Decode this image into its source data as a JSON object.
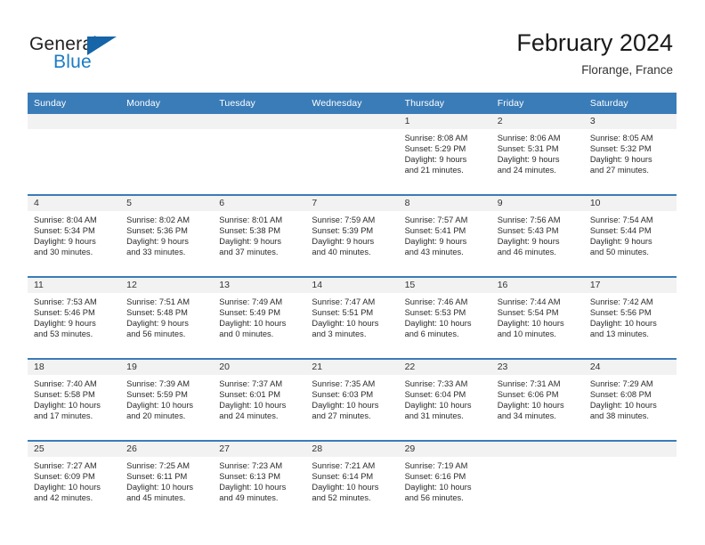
{
  "brand": {
    "name_top": "General",
    "name_bottom": "Blue",
    "accent_color": "#1b7bc4",
    "triangle_color": "#1565a8",
    "triangle_icon": "triangle-icon"
  },
  "header": {
    "title": "February 2024",
    "subtitle": "Florange, France",
    "header_bg_color": "#3a7cb8",
    "daynum_band_color": "#f2f2f2"
  },
  "weekday_headers": [
    "Sunday",
    "Monday",
    "Tuesday",
    "Wednesday",
    "Thursday",
    "Friday",
    "Saturday"
  ],
  "weeks": [
    [
      {
        "day": "",
        "sunrise": "",
        "sunset": "",
        "daylight_1": "",
        "daylight_2": ""
      },
      {
        "day": "",
        "sunrise": "",
        "sunset": "",
        "daylight_1": "",
        "daylight_2": ""
      },
      {
        "day": "",
        "sunrise": "",
        "sunset": "",
        "daylight_1": "",
        "daylight_2": ""
      },
      {
        "day": "",
        "sunrise": "",
        "sunset": "",
        "daylight_1": "",
        "daylight_2": ""
      },
      {
        "day": "1",
        "sunrise": "Sunrise: 8:08 AM",
        "sunset": "Sunset: 5:29 PM",
        "daylight_1": "Daylight: 9 hours",
        "daylight_2": "and 21 minutes."
      },
      {
        "day": "2",
        "sunrise": "Sunrise: 8:06 AM",
        "sunset": "Sunset: 5:31 PM",
        "daylight_1": "Daylight: 9 hours",
        "daylight_2": "and 24 minutes."
      },
      {
        "day": "3",
        "sunrise": "Sunrise: 8:05 AM",
        "sunset": "Sunset: 5:32 PM",
        "daylight_1": "Daylight: 9 hours",
        "daylight_2": "and 27 minutes."
      }
    ],
    [
      {
        "day": "4",
        "sunrise": "Sunrise: 8:04 AM",
        "sunset": "Sunset: 5:34 PM",
        "daylight_1": "Daylight: 9 hours",
        "daylight_2": "and 30 minutes."
      },
      {
        "day": "5",
        "sunrise": "Sunrise: 8:02 AM",
        "sunset": "Sunset: 5:36 PM",
        "daylight_1": "Daylight: 9 hours",
        "daylight_2": "and 33 minutes."
      },
      {
        "day": "6",
        "sunrise": "Sunrise: 8:01 AM",
        "sunset": "Sunset: 5:38 PM",
        "daylight_1": "Daylight: 9 hours",
        "daylight_2": "and 37 minutes."
      },
      {
        "day": "7",
        "sunrise": "Sunrise: 7:59 AM",
        "sunset": "Sunset: 5:39 PM",
        "daylight_1": "Daylight: 9 hours",
        "daylight_2": "and 40 minutes."
      },
      {
        "day": "8",
        "sunrise": "Sunrise: 7:57 AM",
        "sunset": "Sunset: 5:41 PM",
        "daylight_1": "Daylight: 9 hours",
        "daylight_2": "and 43 minutes."
      },
      {
        "day": "9",
        "sunrise": "Sunrise: 7:56 AM",
        "sunset": "Sunset: 5:43 PM",
        "daylight_1": "Daylight: 9 hours",
        "daylight_2": "and 46 minutes."
      },
      {
        "day": "10",
        "sunrise": "Sunrise: 7:54 AM",
        "sunset": "Sunset: 5:44 PM",
        "daylight_1": "Daylight: 9 hours",
        "daylight_2": "and 50 minutes."
      }
    ],
    [
      {
        "day": "11",
        "sunrise": "Sunrise: 7:53 AM",
        "sunset": "Sunset: 5:46 PM",
        "daylight_1": "Daylight: 9 hours",
        "daylight_2": "and 53 minutes."
      },
      {
        "day": "12",
        "sunrise": "Sunrise: 7:51 AM",
        "sunset": "Sunset: 5:48 PM",
        "daylight_1": "Daylight: 9 hours",
        "daylight_2": "and 56 minutes."
      },
      {
        "day": "13",
        "sunrise": "Sunrise: 7:49 AM",
        "sunset": "Sunset: 5:49 PM",
        "daylight_1": "Daylight: 10 hours",
        "daylight_2": "and 0 minutes."
      },
      {
        "day": "14",
        "sunrise": "Sunrise: 7:47 AM",
        "sunset": "Sunset: 5:51 PM",
        "daylight_1": "Daylight: 10 hours",
        "daylight_2": "and 3 minutes."
      },
      {
        "day": "15",
        "sunrise": "Sunrise: 7:46 AM",
        "sunset": "Sunset: 5:53 PM",
        "daylight_1": "Daylight: 10 hours",
        "daylight_2": "and 6 minutes."
      },
      {
        "day": "16",
        "sunrise": "Sunrise: 7:44 AM",
        "sunset": "Sunset: 5:54 PM",
        "daylight_1": "Daylight: 10 hours",
        "daylight_2": "and 10 minutes."
      },
      {
        "day": "17",
        "sunrise": "Sunrise: 7:42 AM",
        "sunset": "Sunset: 5:56 PM",
        "daylight_1": "Daylight: 10 hours",
        "daylight_2": "and 13 minutes."
      }
    ],
    [
      {
        "day": "18",
        "sunrise": "Sunrise: 7:40 AM",
        "sunset": "Sunset: 5:58 PM",
        "daylight_1": "Daylight: 10 hours",
        "daylight_2": "and 17 minutes."
      },
      {
        "day": "19",
        "sunrise": "Sunrise: 7:39 AM",
        "sunset": "Sunset: 5:59 PM",
        "daylight_1": "Daylight: 10 hours",
        "daylight_2": "and 20 minutes."
      },
      {
        "day": "20",
        "sunrise": "Sunrise: 7:37 AM",
        "sunset": "Sunset: 6:01 PM",
        "daylight_1": "Daylight: 10 hours",
        "daylight_2": "and 24 minutes."
      },
      {
        "day": "21",
        "sunrise": "Sunrise: 7:35 AM",
        "sunset": "Sunset: 6:03 PM",
        "daylight_1": "Daylight: 10 hours",
        "daylight_2": "and 27 minutes."
      },
      {
        "day": "22",
        "sunrise": "Sunrise: 7:33 AM",
        "sunset": "Sunset: 6:04 PM",
        "daylight_1": "Daylight: 10 hours",
        "daylight_2": "and 31 minutes."
      },
      {
        "day": "23",
        "sunrise": "Sunrise: 7:31 AM",
        "sunset": "Sunset: 6:06 PM",
        "daylight_1": "Daylight: 10 hours",
        "daylight_2": "and 34 minutes."
      },
      {
        "day": "24",
        "sunrise": "Sunrise: 7:29 AM",
        "sunset": "Sunset: 6:08 PM",
        "daylight_1": "Daylight: 10 hours",
        "daylight_2": "and 38 minutes."
      }
    ],
    [
      {
        "day": "25",
        "sunrise": "Sunrise: 7:27 AM",
        "sunset": "Sunset: 6:09 PM",
        "daylight_1": "Daylight: 10 hours",
        "daylight_2": "and 42 minutes."
      },
      {
        "day": "26",
        "sunrise": "Sunrise: 7:25 AM",
        "sunset": "Sunset: 6:11 PM",
        "daylight_1": "Daylight: 10 hours",
        "daylight_2": "and 45 minutes."
      },
      {
        "day": "27",
        "sunrise": "Sunrise: 7:23 AM",
        "sunset": "Sunset: 6:13 PM",
        "daylight_1": "Daylight: 10 hours",
        "daylight_2": "and 49 minutes."
      },
      {
        "day": "28",
        "sunrise": "Sunrise: 7:21 AM",
        "sunset": "Sunset: 6:14 PM",
        "daylight_1": "Daylight: 10 hours",
        "daylight_2": "and 52 minutes."
      },
      {
        "day": "29",
        "sunrise": "Sunrise: 7:19 AM",
        "sunset": "Sunset: 6:16 PM",
        "daylight_1": "Daylight: 10 hours",
        "daylight_2": "and 56 minutes."
      },
      {
        "day": "",
        "sunrise": "",
        "sunset": "",
        "daylight_1": "",
        "daylight_2": ""
      },
      {
        "day": "",
        "sunrise": "",
        "sunset": "",
        "daylight_1": "",
        "daylight_2": ""
      }
    ]
  ]
}
